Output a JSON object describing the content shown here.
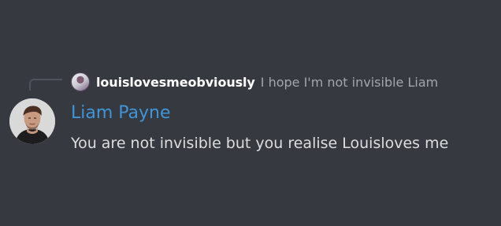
{
  "reply": {
    "author": "louislovesmeobviously",
    "content": "I hope I'm not invisible Liam",
    "avatar_icon": "user-avatar-icon"
  },
  "message": {
    "author": "Liam Payne",
    "content": "You are not invisible but you realise Louisloves me",
    "avatar_icon": "user-avatar-icon"
  },
  "colors": {
    "background": "#36393f",
    "author_name": "#3f95d8",
    "message_text": "#dcddde",
    "reply_text": "#a3a6aa",
    "reply_author": "#ffffff",
    "reply_spine": "#4f545c"
  }
}
